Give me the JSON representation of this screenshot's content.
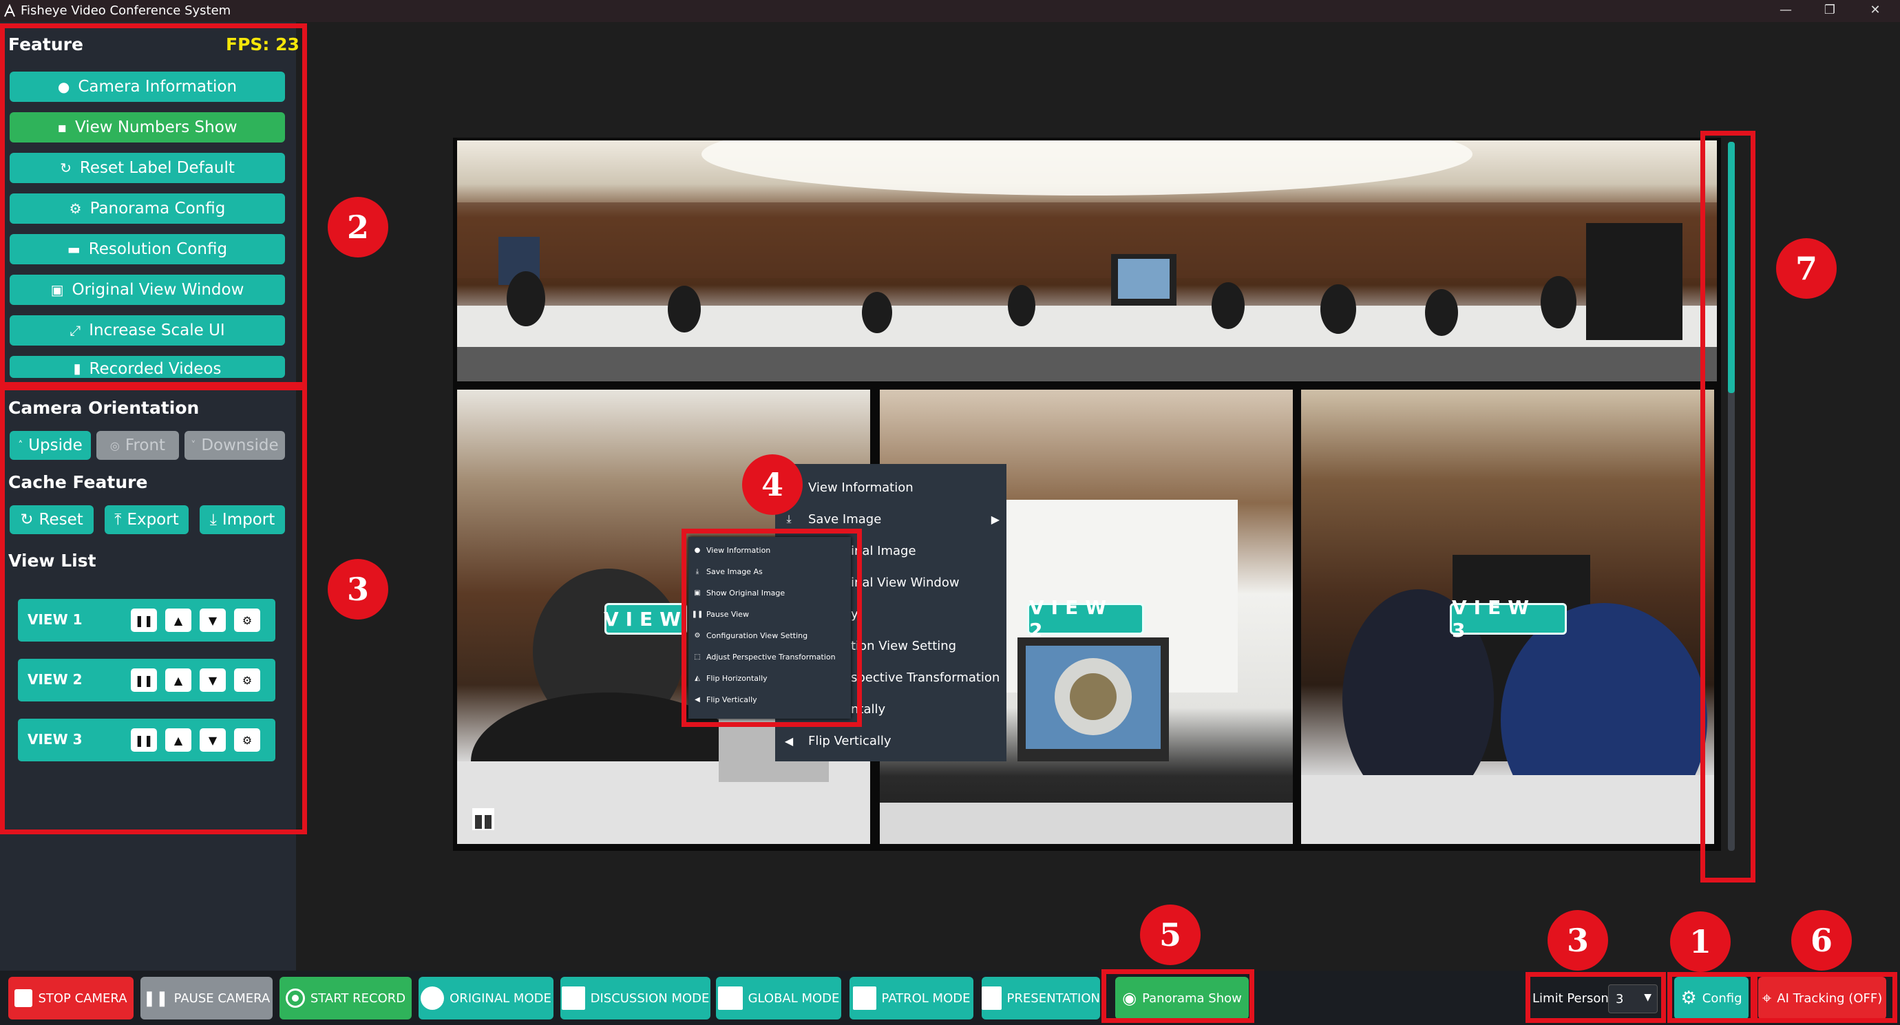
{
  "app": {
    "title": "Fisheye Video Conference System"
  },
  "window_controls": {
    "minimize": "—",
    "maximize": "❐",
    "close": "✕"
  },
  "sidebar": {
    "feature_title": "Feature",
    "fps": "FPS: 23",
    "features": [
      {
        "label": "Camera Information",
        "icon": "info-icon"
      },
      {
        "label": "View Numbers Show",
        "icon": "numbers-icon"
      },
      {
        "label": "Reset Label Default",
        "icon": "reset-icon"
      },
      {
        "label": "Panorama Config",
        "icon": "gear-icon"
      },
      {
        "label": "Resolution Config",
        "icon": "resolution-icon"
      },
      {
        "label": "Original View Window",
        "icon": "window-icon"
      },
      {
        "label": "Increase Scale UI",
        "icon": "scale-icon"
      },
      {
        "label": "Recorded Videos",
        "icon": "file-icon"
      }
    ],
    "orientation_title": "Camera Orientation",
    "orientation": {
      "upside": "Upside",
      "front": "Front",
      "downside": "Downside",
      "selected": "Upside"
    },
    "cache_title": "Cache Feature",
    "cache": {
      "reset": "Reset",
      "export": "Export",
      "import": "Import"
    },
    "viewlist_title": "View List",
    "views": [
      "VIEW 1",
      "VIEW 2",
      "VIEW 3"
    ]
  },
  "video": {
    "badges": [
      "VIEW 1",
      "VIEW 2",
      "VIEW 3"
    ],
    "badge_visible_text": [
      "VIEW",
      "VIEW 2",
      "VIEW 3"
    ]
  },
  "context_menu_large": {
    "items": [
      "View Information",
      "Save Image",
      "inal Image",
      "inal View Window",
      "y",
      "tion View Setting",
      "spective Transformation",
      "ntally",
      "Flip Vertically"
    ]
  },
  "context_menu_small": {
    "items": [
      "View Information",
      "Save Image As",
      "Show Original Image",
      "Pause View",
      "Configuration View Setting",
      "Adjust Perspective Transformation",
      "Flip Horizontally",
      "Flip Vertically"
    ]
  },
  "bottom_bar": {
    "stop_camera": "STOP CAMERA",
    "pause_camera": "PAUSE CAMERA",
    "start_record": "START RECORD",
    "original_mode": "ORIGINAL MODE",
    "discussion_mode": "DISCUSSION MODE",
    "global_mode": "GLOBAL MODE",
    "patrol_mode": "PATROL MODE",
    "presentation": "PRESENTATION",
    "panorama_show": "Panorama Show",
    "limit_person_label": "Limit Person:",
    "limit_person_value": "3",
    "config": "Config",
    "ai_tracking": "AI Tracking (OFF)"
  },
  "annotations": [
    "1",
    "2",
    "3",
    "3",
    "4",
    "5",
    "6",
    "7"
  ],
  "colors": {
    "accent": "#1bb7a5",
    "green": "#2fb35a",
    "stop": "#e5252b",
    "annotation": "#e3121d",
    "fps": "#f5e60a"
  }
}
